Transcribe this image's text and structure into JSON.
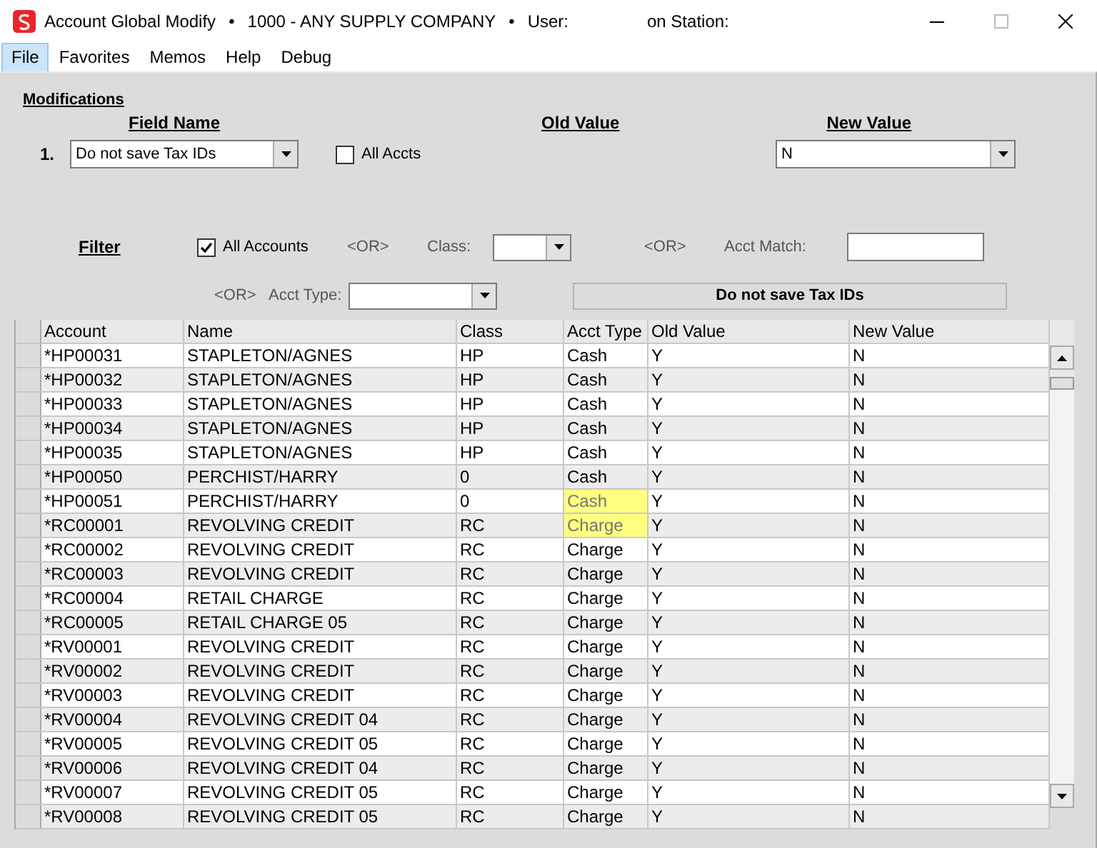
{
  "window": {
    "title_parts": [
      "Account Global Modify",
      "•",
      "1000 - ANY SUPPLY COMPANY",
      "•",
      "User:",
      "on Station:"
    ]
  },
  "menu": [
    {
      "label": "File",
      "selected": true
    },
    {
      "label": "Favorites",
      "selected": false
    },
    {
      "label": "Memos",
      "selected": false
    },
    {
      "label": "Help",
      "selected": false
    },
    {
      "label": "Debug",
      "selected": false
    }
  ],
  "modifications": {
    "title": "Modifications",
    "headings": [
      "Field Name",
      "Old Value",
      "New Value"
    ],
    "row_number": "1.",
    "field_name": "Do not save Tax IDs",
    "all_accts": {
      "label": "All Accts",
      "checked": false
    },
    "new_value": "N"
  },
  "filter": {
    "title": "Filter",
    "all_accounts": {
      "label": "All Accounts",
      "checked": true
    },
    "or_1": "<OR>",
    "class_label": "Class:",
    "or_2": "<OR>",
    "acct_match_label": "Acct Match:",
    "or_3": "<OR>",
    "acct_type_label": "Acct Type:",
    "field_banner": "Do not save Tax IDs"
  },
  "table": {
    "columns": [
      "Account",
      "Name",
      "Class",
      "Acct Type",
      "Old Value",
      "New Value"
    ],
    "rows": [
      {
        "cells": [
          "*HP00031",
          "STAPLETON/AGNES",
          "HP",
          "Cash",
          "Y",
          "N"
        ],
        "type_highlighted": false
      },
      {
        "cells": [
          "*HP00032",
          "STAPLETON/AGNES",
          "HP",
          "Cash",
          "Y",
          "N"
        ],
        "type_highlighted": false
      },
      {
        "cells": [
          "*HP00033",
          "STAPLETON/AGNES",
          "HP",
          "Cash",
          "Y",
          "N"
        ],
        "type_highlighted": false
      },
      {
        "cells": [
          "*HP00034",
          "STAPLETON/AGNES",
          "HP",
          "Cash",
          "Y",
          "N"
        ],
        "type_highlighted": false
      },
      {
        "cells": [
          "*HP00035",
          "STAPLETON/AGNES",
          "HP",
          "Cash",
          "Y",
          "N"
        ],
        "type_highlighted": false
      },
      {
        "cells": [
          "*HP00050",
          "PERCHIST/HARRY",
          "0",
          "Cash",
          "Y",
          "N"
        ],
        "type_highlighted": false
      },
      {
        "cells": [
          "*HP00051",
          "PERCHIST/HARRY",
          "0",
          "Cash",
          "Y",
          "N"
        ],
        "type_highlighted": true
      },
      {
        "cells": [
          "*RC00001",
          "REVOLVING CREDIT",
          "RC",
          "Charge",
          "Y",
          "N"
        ],
        "type_highlighted": true
      },
      {
        "cells": [
          "*RC00002",
          "REVOLVING CREDIT",
          "RC",
          "Charge",
          "Y",
          "N"
        ],
        "type_highlighted": false
      },
      {
        "cells": [
          "*RC00003",
          "REVOLVING CREDIT",
          "RC",
          "Charge",
          "Y",
          "N"
        ],
        "type_highlighted": false
      },
      {
        "cells": [
          "*RC00004",
          "RETAIL CHARGE",
          "RC",
          "Charge",
          "Y",
          "N"
        ],
        "type_highlighted": false
      },
      {
        "cells": [
          "*RC00005",
          "RETAIL CHARGE 05",
          "RC",
          "Charge",
          "Y",
          "N"
        ],
        "type_highlighted": false
      },
      {
        "cells": [
          "*RV00001",
          "REVOLVING CREDIT",
          "RC",
          "Charge",
          "Y",
          "N"
        ],
        "type_highlighted": false
      },
      {
        "cells": [
          "*RV00002",
          "REVOLVING CREDIT",
          "RC",
          "Charge",
          "Y",
          "N"
        ],
        "type_highlighted": false
      },
      {
        "cells": [
          "*RV00003",
          "REVOLVING CREDIT",
          "RC",
          "Charge",
          "Y",
          "N"
        ],
        "type_highlighted": false
      },
      {
        "cells": [
          "*RV00004",
          "REVOLVING CREDIT 04",
          "RC",
          "Charge",
          "Y",
          "N"
        ],
        "type_highlighted": false
      },
      {
        "cells": [
          "*RV00005",
          "REVOLVING CREDIT 05",
          "RC",
          "Charge",
          "Y",
          "N"
        ],
        "type_highlighted": false
      },
      {
        "cells": [
          "*RV00006",
          "REVOLVING CREDIT 04",
          "RC",
          "Charge",
          "Y",
          "N"
        ],
        "type_highlighted": false
      },
      {
        "cells": [
          "*RV00007",
          "REVOLVING CREDIT 05",
          "RC",
          "Charge",
          "Y",
          "N"
        ],
        "type_highlighted": false
      },
      {
        "cells": [
          "*RV00008",
          "REVOLVING CREDIT 05",
          "RC",
          "Charge",
          "Y",
          "N"
        ],
        "type_highlighted": false
      }
    ]
  }
}
